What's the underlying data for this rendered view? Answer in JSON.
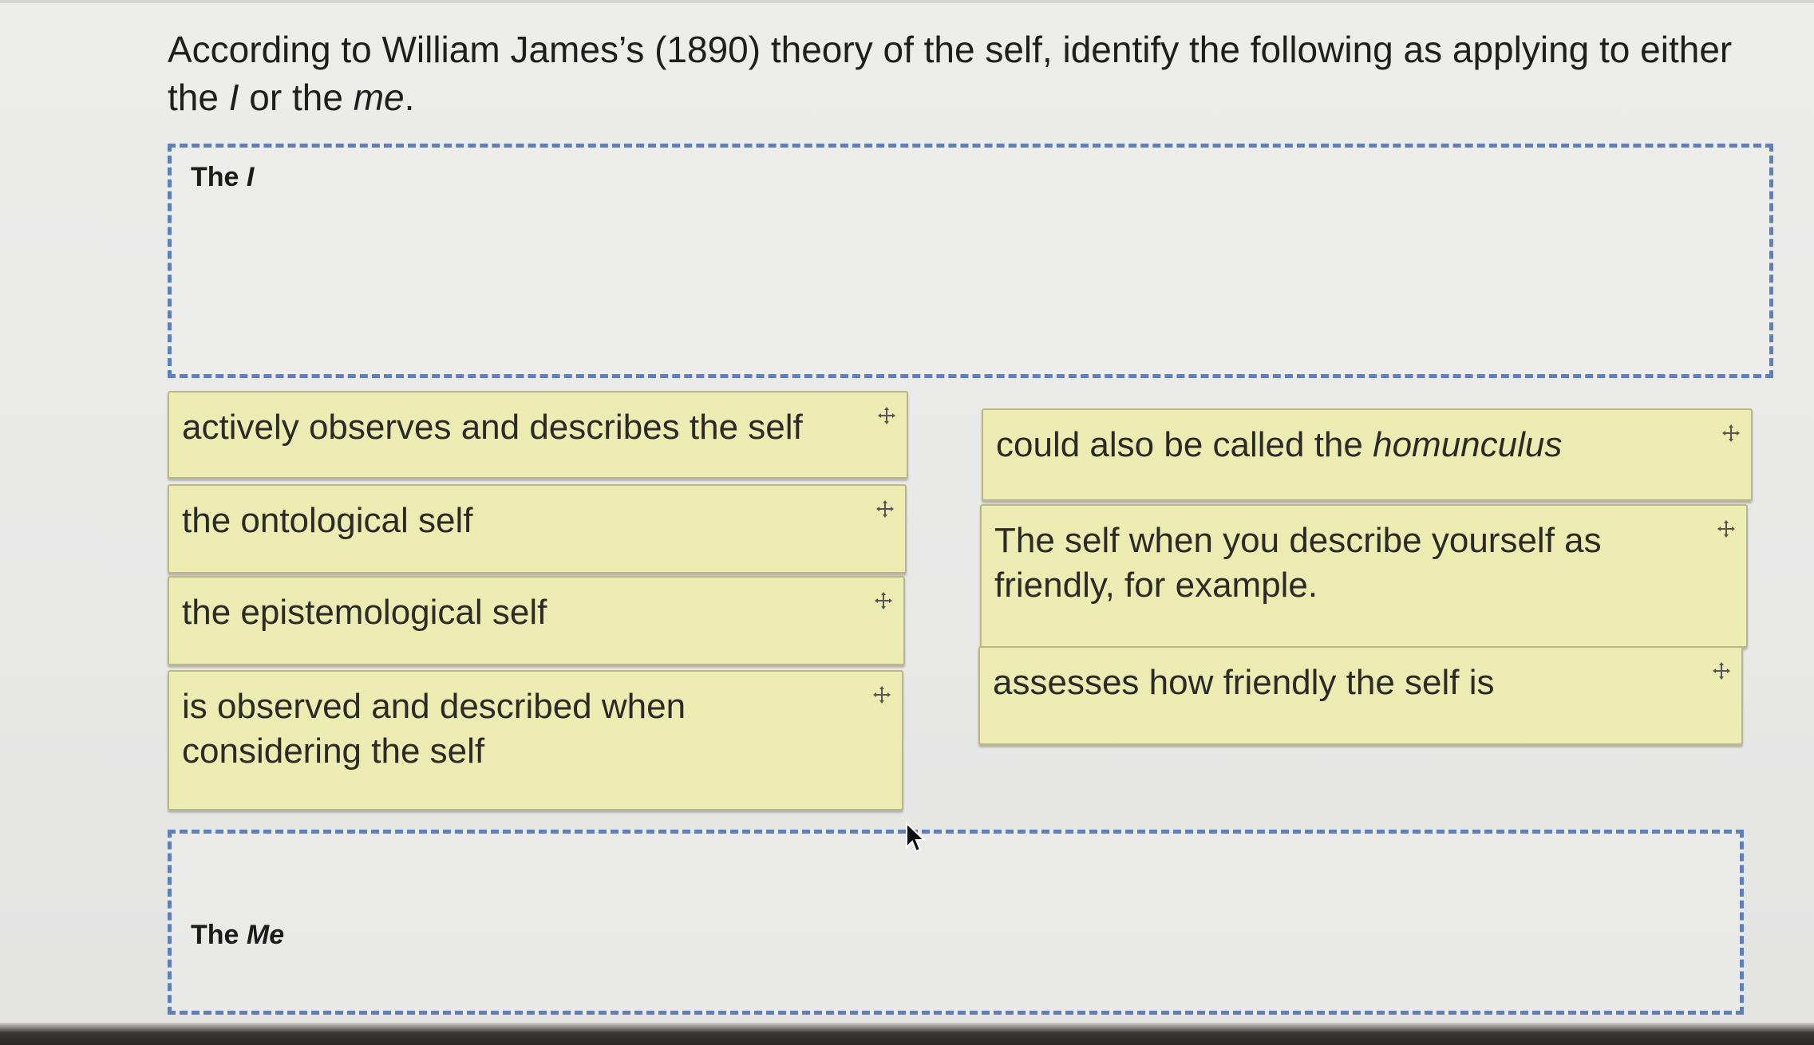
{
  "question": {
    "part1": "According to William James’s (1890) theory of the self, identify the following as applying to either the ",
    "i_term": "I",
    "part2": " or the ",
    "me_term": "me",
    "part3": "."
  },
  "zones": {
    "i": {
      "label_prefix": "The ",
      "label_em": "I"
    },
    "me": {
      "label_prefix": "The ",
      "label_em": "Me"
    }
  },
  "cards": {
    "c1": {
      "text": "actively observes and describes the self",
      "icon": "move-icon"
    },
    "c2": {
      "text": "the ontological self",
      "icon": "move-icon"
    },
    "c3": {
      "text": "the epistemological self",
      "icon": "move-icon"
    },
    "c4": {
      "text": "is observed and described when considering the self",
      "icon": "move-icon"
    },
    "c5": {
      "text": "could also be called the ",
      "text_em": "homunculus",
      "icon": "move-icon"
    },
    "c6": {
      "text": "The self when you describe yourself as friendly, for example.",
      "icon": "move-icon"
    },
    "c7": {
      "text": "assesses how friendly the self is",
      "icon": "move-icon"
    }
  },
  "colors": {
    "card_bg": "#ecebb2",
    "card_border": "#b9b78a",
    "dropzone_border": "#5f7fb8",
    "page_bg": "#ebebea"
  }
}
